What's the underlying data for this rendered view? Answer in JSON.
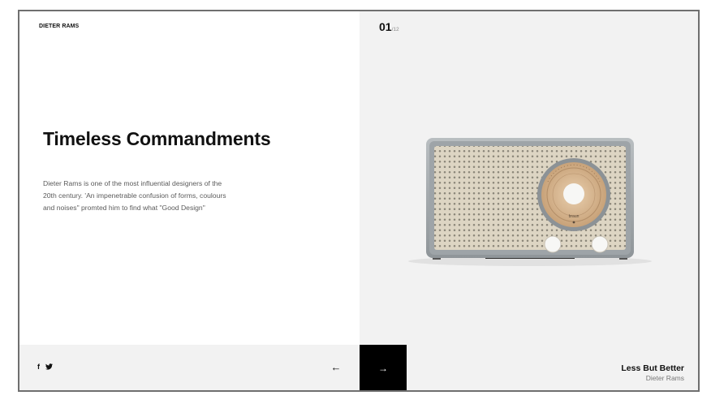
{
  "header": {
    "brand": "DIETER RAMS"
  },
  "hero": {
    "title": "Timeless Commandments",
    "description": "Dieter Rams is one of the most influential designers of the 20th century. 'An impenetrable confusion of forms, coulours and noises\" promted him to find what \"Good Design\""
  },
  "slide": {
    "current": "01",
    "total": "/12",
    "product_brand": "braun",
    "caption_title": "Less But Better",
    "caption_subtitle": "Dieter Rams"
  },
  "footer": {
    "facebook_icon": "f",
    "twitter_icon": "twitter-bird-icon",
    "prev_arrow": "←",
    "next_arrow": "→"
  },
  "colors": {
    "left_background": "#ffffff",
    "right_background": "#f2f2f2",
    "next_button": "#000000",
    "border": "#6f6f6f"
  }
}
